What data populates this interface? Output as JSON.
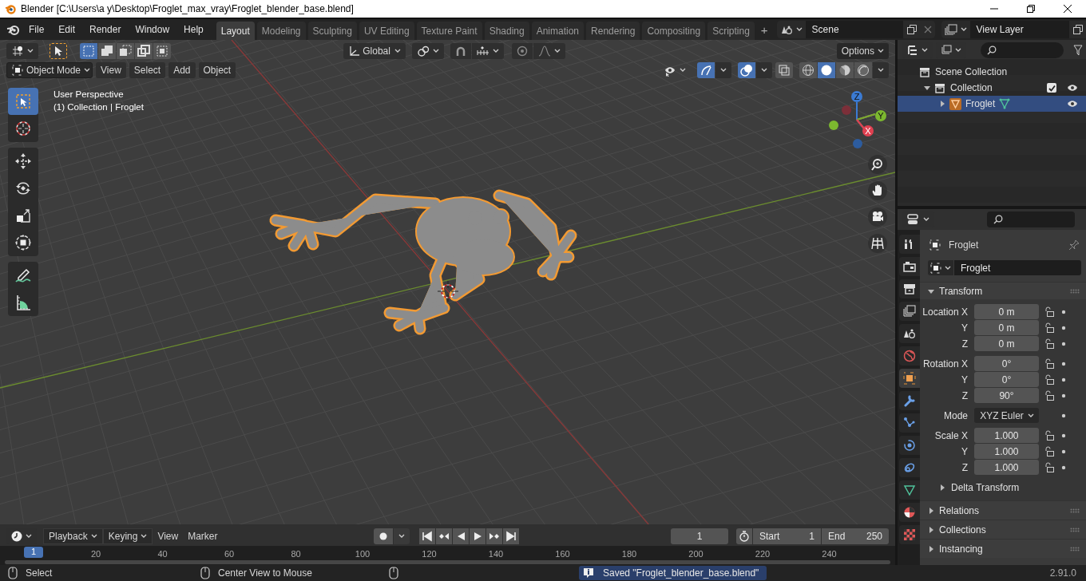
{
  "window": {
    "title": "Blender [C:\\Users\\a y\\Desktop\\Froglet_max_vray\\Froglet_blender_base.blend]"
  },
  "menu": [
    "File",
    "Edit",
    "Render",
    "Window",
    "Help"
  ],
  "workspaces": [
    {
      "label": "Layout",
      "selected": true
    },
    {
      "label": "Modeling",
      "selected": false
    },
    {
      "label": "Sculpting",
      "selected": false
    },
    {
      "label": "UV Editing",
      "selected": false
    },
    {
      "label": "Texture Paint",
      "selected": false
    },
    {
      "label": "Shading",
      "selected": false
    },
    {
      "label": "Animation",
      "selected": false
    },
    {
      "label": "Rendering",
      "selected": false
    },
    {
      "label": "Compositing",
      "selected": false
    },
    {
      "label": "Scripting",
      "selected": false
    }
  ],
  "add_workspace": "+",
  "scene": "Scene",
  "view_layer": "View Layer",
  "tool_header": {
    "select_modes": [
      {
        "kind": "set",
        "selected": true
      },
      {
        "kind": "extend",
        "selected": false
      },
      {
        "kind": "subtract",
        "selected": false
      },
      {
        "kind": "difference",
        "selected": false
      },
      {
        "kind": "intersect",
        "selected": false
      }
    ],
    "orientation": "Global",
    "options": "Options"
  },
  "view_header": {
    "mode": "Object Mode",
    "menus": [
      "View",
      "Select",
      "Add",
      "Object"
    ],
    "gizmos_on": true,
    "overlays_on": true,
    "xray_on": false,
    "shading": [
      {
        "kind": "wireframe",
        "selected": false
      },
      {
        "kind": "solid",
        "selected": true
      },
      {
        "kind": "material",
        "selected": false
      },
      {
        "kind": "rendered",
        "selected": false
      }
    ]
  },
  "viewport_info": [
    "User Perspective",
    "(1) Collection | Froglet"
  ],
  "toolbar": [
    [
      {
        "kind": "select_box",
        "selected": true
      },
      {
        "kind": "cursor",
        "selected": false
      }
    ],
    [
      {
        "kind": "move",
        "selected": false
      },
      {
        "kind": "rotate",
        "selected": false
      },
      {
        "kind": "scale",
        "selected": false
      },
      {
        "kind": "transform",
        "selected": false
      }
    ],
    [
      {
        "kind": "annotate",
        "selected": false
      },
      {
        "kind": "measure",
        "selected": false
      }
    ]
  ],
  "gizmo": {
    "z": "Z",
    "y": "Y",
    "x": "X"
  },
  "outliner": {
    "tree": [
      {
        "label": "Scene Collection",
        "kind": "scene_collection",
        "selected": false,
        "children": [
          {
            "label": "Collection",
            "kind": "collection",
            "expanded": true,
            "checked": true,
            "visible": true,
            "selected": false,
            "children": [
              {
                "label": "Froglet",
                "kind": "object",
                "expanded": false,
                "visible": true,
                "selected": true
              }
            ]
          }
        ]
      }
    ]
  },
  "properties": {
    "tabs": [
      {
        "kind": "tool",
        "selected": false
      },
      {
        "kind": "render",
        "selected": false
      },
      {
        "kind": "output",
        "selected": false
      },
      {
        "kind": "view_layer",
        "selected": false
      },
      {
        "kind": "scene",
        "selected": false
      },
      {
        "kind": "world",
        "selected": false
      },
      {
        "kind": "object",
        "selected": true
      },
      {
        "kind": "modifiers",
        "selected": false
      },
      {
        "kind": "particles",
        "selected": false
      },
      {
        "kind": "physics",
        "selected": false
      },
      {
        "kind": "constraints",
        "selected": false
      },
      {
        "kind": "data",
        "selected": false
      },
      {
        "kind": "material",
        "selected": false
      },
      {
        "kind": "texture",
        "selected": false
      }
    ],
    "context": "Froglet",
    "name": "Froglet",
    "transform": {
      "label": "Transform",
      "expanded": true,
      "groups": [
        {
          "fields": [
            {
              "kind": "number",
              "label": "Location X",
              "value": "0 m"
            },
            {
              "kind": "number",
              "label": "Y",
              "value": "0 m"
            },
            {
              "kind": "number",
              "label": "Z",
              "value": "0 m"
            }
          ]
        },
        {
          "fields": [
            {
              "kind": "number",
              "label": "Rotation X",
              "value": "0°"
            },
            {
              "kind": "number",
              "label": "Y",
              "value": "0°"
            },
            {
              "kind": "number",
              "label": "Z",
              "value": "90°"
            }
          ]
        },
        {
          "fields": [
            {
              "kind": "dropdown",
              "label": "Mode",
              "value": "XYZ Euler"
            }
          ]
        },
        {
          "fields": [
            {
              "kind": "number",
              "label": "Scale X",
              "value": "1.000"
            },
            {
              "kind": "number",
              "label": "Y",
              "value": "1.000"
            },
            {
              "kind": "number",
              "label": "Z",
              "value": "1.000"
            }
          ]
        }
      ],
      "subpanels": [
        {
          "label": "Delta Transform",
          "expanded": false
        }
      ]
    },
    "panels": [
      {
        "label": "Relations",
        "expanded": false
      },
      {
        "label": "Collections",
        "expanded": false
      },
      {
        "label": "Instancing",
        "expanded": false
      }
    ]
  },
  "timeline": {
    "menus": [
      {
        "label": "Playback",
        "dropdown": true
      },
      {
        "label": "Keying",
        "dropdown": true
      },
      {
        "label": "View",
        "dropdown": false
      },
      {
        "label": "Marker",
        "dropdown": false
      }
    ],
    "current_frame": "1",
    "start": {
      "label": "Start",
      "value": "1"
    },
    "end": {
      "label": "End",
      "value": "250"
    },
    "playhead": "1",
    "ticks": [
      "20",
      "40",
      "60",
      "80",
      "100",
      "120",
      "140",
      "160",
      "180",
      "200",
      "220",
      "240"
    ]
  },
  "status_bar": {
    "hints": [
      {
        "label": "Select"
      },
      {
        "label": "Center View to Mouse"
      }
    ],
    "message": "Saved \"Froglet_blender_base.blend\"",
    "version": "2.91.0"
  }
}
